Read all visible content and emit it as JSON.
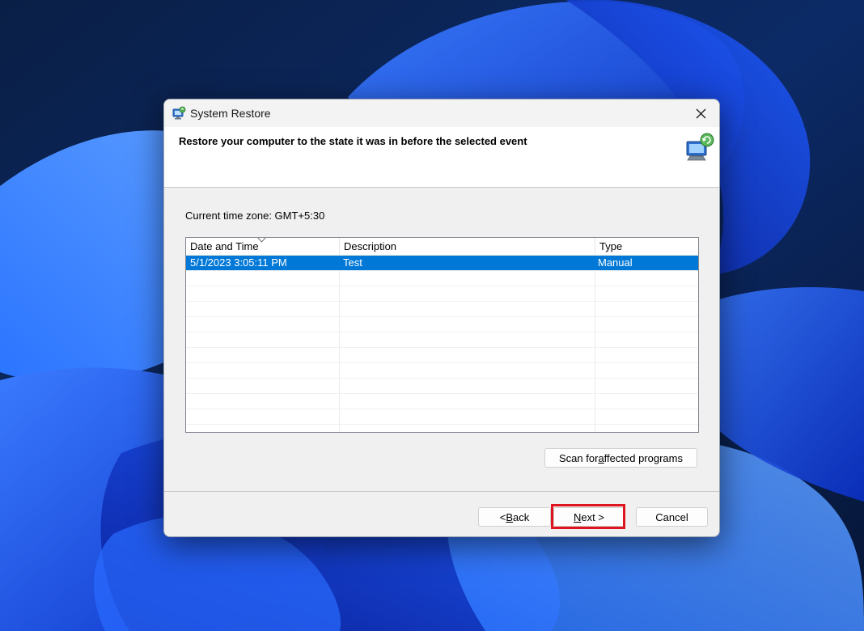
{
  "window": {
    "title": "System Restore",
    "heading": "Restore your computer to the state it was in before the selected event"
  },
  "timezone_label": "Current time zone: GMT+5:30",
  "restore_points": {
    "columns": [
      "Date and Time",
      "Description",
      "Type"
    ],
    "rows": [
      {
        "date": "5/1/2023 3:05:11 PM",
        "description": "Test",
        "type": "Manual",
        "selected": true
      }
    ]
  },
  "buttons": {
    "scan": {
      "pre": "Scan for ",
      "access": "a",
      "post": "ffected programs"
    },
    "back": {
      "pre": "< ",
      "access": "B",
      "post": "ack"
    },
    "next": {
      "pre": "",
      "access": "N",
      "post": "ext >"
    },
    "cancel": "Cancel"
  },
  "colors": {
    "selection": "#0078d7",
    "highlight_border": "#e0141e"
  },
  "icons": {
    "title": "system-restore-icon",
    "header": "computer-restore-icon",
    "close": "close-icon",
    "sort": "sort-descending-icon"
  }
}
